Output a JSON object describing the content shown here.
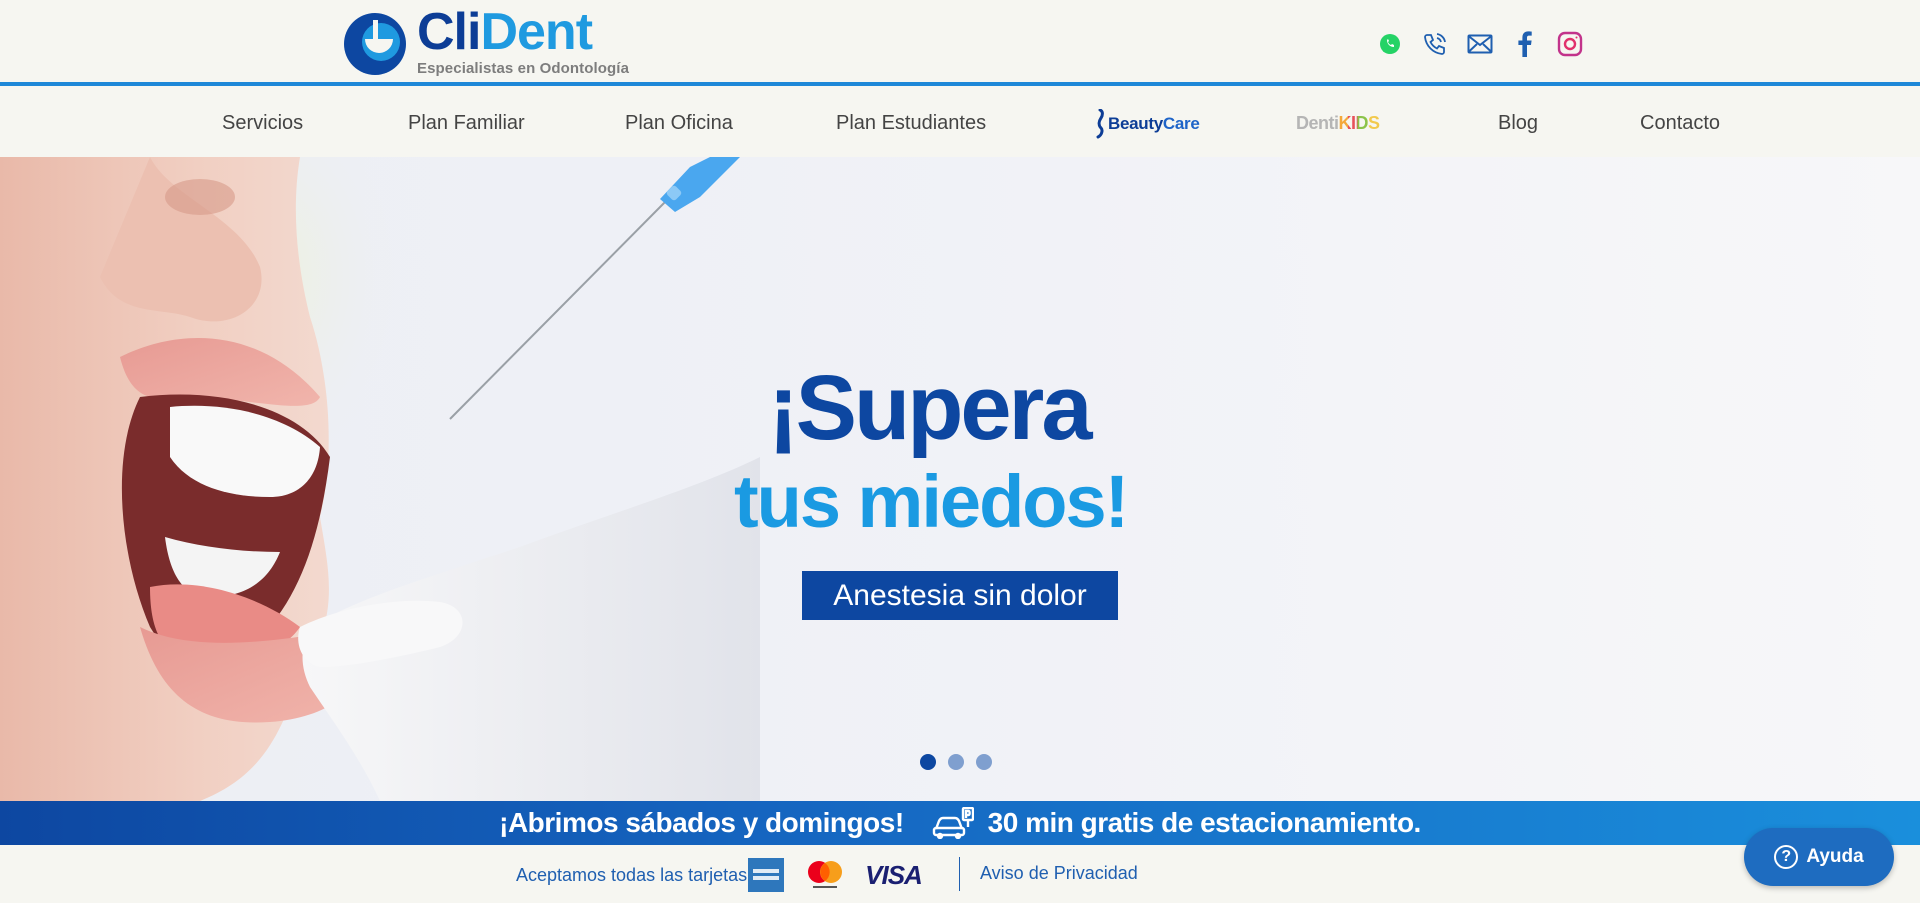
{
  "brand": {
    "name_part1": "Cli",
    "name_part2": "Dent",
    "tagline": "Especialistas en Odontología",
    "colors": {
      "dark_blue": "#0d3d96",
      "light_blue": "#1f9ae0",
      "hero_button": "#0d47a1"
    }
  },
  "social": [
    {
      "icon": "whatsapp-icon",
      "color": "#25d366"
    },
    {
      "icon": "phone-icon",
      "color": "#1f5fb0"
    },
    {
      "icon": "mail-icon",
      "color": "#1f5fb0"
    },
    {
      "icon": "facebook-icon",
      "color": "#1f5fb0"
    },
    {
      "icon": "instagram-icon",
      "color": "#d6249f"
    }
  ],
  "nav": {
    "servicios": "Servicios",
    "plan_familiar": "Plan Familiar",
    "plan_oficina": "Plan Oficina",
    "plan_estudiantes": "Plan Estudiantes",
    "beautycare_part1": "Beauty",
    "beautycare_part2": "Care",
    "dentikids_part1": "Denti",
    "dentikids_part2": "KIDS",
    "blog": "Blog",
    "contacto": "Contacto"
  },
  "hero": {
    "line1": "¡Supera",
    "line2": "tus miedos!",
    "button": "Anestesia sin dolor",
    "slides_total": 3,
    "active_slide": 1
  },
  "infobar": {
    "weekend": "¡Abrimos sábados y domingos!",
    "parking": "30 min gratis de estacionamiento."
  },
  "footer": {
    "cards_label": "Aceptamos todas las tarjetas",
    "cards": [
      "amex-icon",
      "mastercard-icon",
      "visa-icon"
    ],
    "visa_text": "VISA",
    "privacy": "Aviso de Privacidad"
  },
  "help": {
    "label": "Ayuda"
  }
}
